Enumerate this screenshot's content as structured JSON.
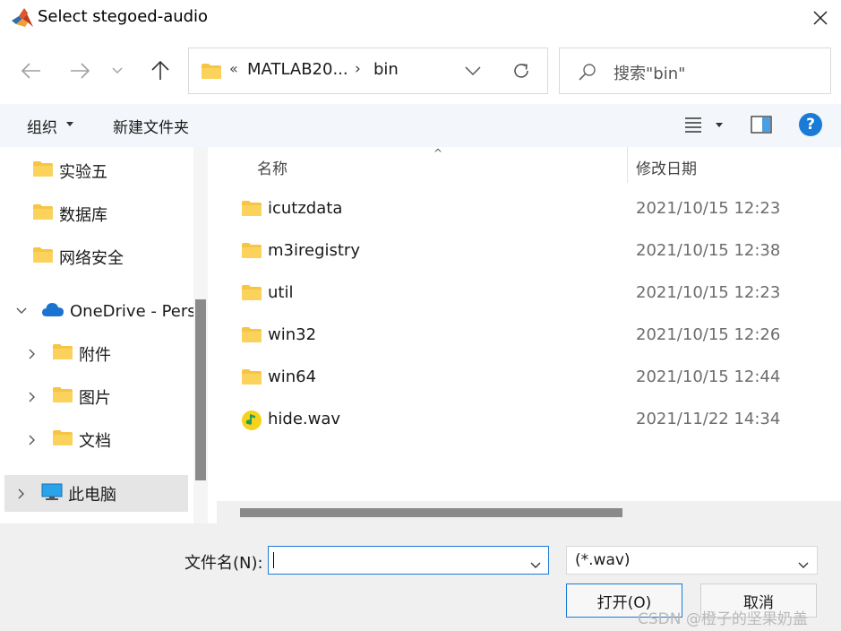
{
  "window": {
    "title": "Select stegoed-audio",
    "app_icon": "matlab-icon",
    "close_icon": "close-icon"
  },
  "navigation": {
    "back_icon": "arrow-left-icon",
    "forward_icon": "arrow-right-icon",
    "recent_icon": "chevron-down-icon",
    "up_icon": "arrow-up-icon"
  },
  "address": {
    "overflow": "«",
    "segments": [
      "MATLAB20...",
      "bin"
    ],
    "separator": "›",
    "refresh_icon": "refresh-icon"
  },
  "search": {
    "placeholder": "搜索\"bin\""
  },
  "toolbar": {
    "organize_label": "组织",
    "new_folder_label": "新建文件夹",
    "view_icon": "list-view-icon",
    "preview_pane_icon": "preview-pane-icon",
    "help_label": "?"
  },
  "sidebar": {
    "items": [
      {
        "label": "实验五",
        "icon": "folder-icon",
        "level": 2,
        "expander": ""
      },
      {
        "label": "数据库",
        "icon": "folder-icon",
        "level": 2,
        "expander": ""
      },
      {
        "label": "网络安全",
        "icon": "folder-icon",
        "level": 2,
        "expander": ""
      },
      {
        "label": "OneDrive - Pers",
        "icon": "cloud-icon",
        "level": 1,
        "expander": "expanded"
      },
      {
        "label": "附件",
        "icon": "folder-icon",
        "level": 2,
        "expander": "collapsed"
      },
      {
        "label": "图片",
        "icon": "folder-icon",
        "level": 2,
        "expander": "collapsed"
      },
      {
        "label": "文档",
        "icon": "folder-icon",
        "level": 2,
        "expander": "collapsed"
      },
      {
        "label": "此电脑",
        "icon": "computer-icon",
        "level": 1,
        "expander": "collapsed",
        "selected": true
      }
    ]
  },
  "file_list": {
    "columns": {
      "name": "名称",
      "date_modified": "修改日期"
    },
    "sort_indicator": "^",
    "rows": [
      {
        "name": "icutzdata",
        "date": "2021/10/15 12:23",
        "icon": "folder-icon"
      },
      {
        "name": "m3iregistry",
        "date": "2021/10/15 12:38",
        "icon": "folder-icon"
      },
      {
        "name": "util",
        "date": "2021/10/15 12:23",
        "icon": "folder-icon"
      },
      {
        "name": "win32",
        "date": "2021/10/15 12:26",
        "icon": "folder-icon"
      },
      {
        "name": "win64",
        "date": "2021/10/15 12:44",
        "icon": "folder-icon"
      },
      {
        "name": "hide.wav",
        "date": "2021/11/22 14:34",
        "icon": "audio-file-icon"
      }
    ]
  },
  "bottom": {
    "filename_label": "文件名(N):",
    "filename_value": "",
    "filetype_value": "(*.wav)",
    "open_label": "打开(O)",
    "cancel_label": "取消",
    "watermark": "CSDN @橙子的坚果奶盖"
  },
  "colors": {
    "accent": "#1a7bd6",
    "folder_yellow": "#f6c544",
    "toolbar_bg": "#f3f6fa",
    "selected_bg": "#e5e5e5"
  }
}
